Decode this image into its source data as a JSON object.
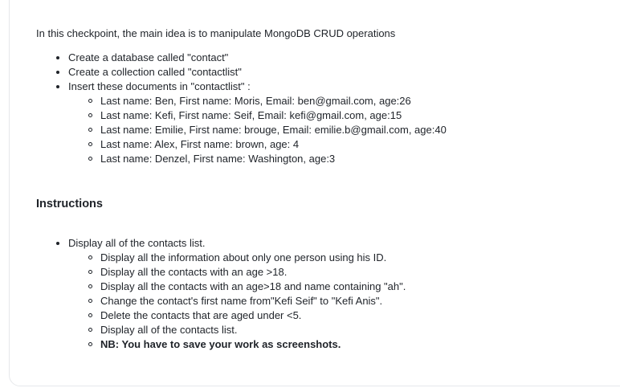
{
  "intro": "In this checkpoint, the main idea is to manipulate MongoDB CRUD operations",
  "tasks": [
    "Create a database called \"contact\"",
    "Create a collection called \"contactlist\"",
    "Insert these documents  in \"contactlist\" :"
  ],
  "documents": [
    "Last name: Ben, First name: Moris, Email: ben@gmail.com, age:26",
    "Last name: Kefi, First name: Seif, Email: kefi@gmail.com, age:15",
    "Last name: Emilie, First name: brouge, Email: emilie.b@gmail.com, age:40",
    "Last name: Alex, First name: brown, age: 4",
    "Last name: Denzel, First name: Washington, age:3"
  ],
  "instructions_heading": "Instructions",
  "instruction_main": "Display all of the contacts list.",
  "instruction_steps": [
    "Display all the information about only one person using his ID.",
    "Display all the contacts with an age >18.",
    "Display all the contacts with an age>18 and name containing \"ah\".",
    "Change the contact's first name from\"Kefi Seif\" to \"Kefi Anis\".",
    "Delete the contacts that are aged under <5.",
    "Display all of the contacts list.",
    "NB: You have to save your work as screenshots."
  ]
}
